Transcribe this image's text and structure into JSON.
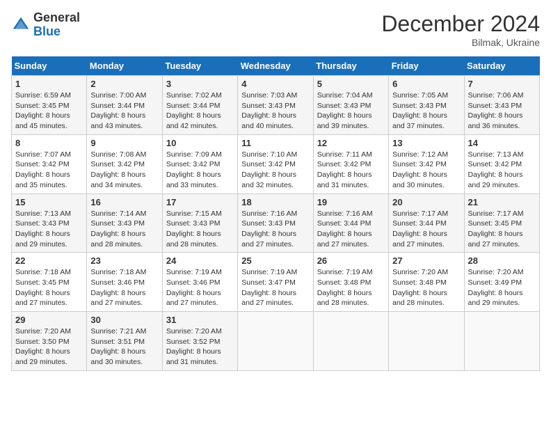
{
  "header": {
    "logo_general": "General",
    "logo_blue": "Blue",
    "month_title": "December 2024",
    "subtitle": "Bilmak, Ukraine"
  },
  "weekdays": [
    "Sunday",
    "Monday",
    "Tuesday",
    "Wednesday",
    "Thursday",
    "Friday",
    "Saturday"
  ],
  "weeks": [
    [
      {
        "day": "1",
        "sunrise": "Sunrise: 6:59 AM",
        "sunset": "Sunset: 3:45 PM",
        "daylight": "Daylight: 8 hours and 45 minutes."
      },
      {
        "day": "2",
        "sunrise": "Sunrise: 7:00 AM",
        "sunset": "Sunset: 3:44 PM",
        "daylight": "Daylight: 8 hours and 43 minutes."
      },
      {
        "day": "3",
        "sunrise": "Sunrise: 7:02 AM",
        "sunset": "Sunset: 3:44 PM",
        "daylight": "Daylight: 8 hours and 42 minutes."
      },
      {
        "day": "4",
        "sunrise": "Sunrise: 7:03 AM",
        "sunset": "Sunset: 3:43 PM",
        "daylight": "Daylight: 8 hours and 40 minutes."
      },
      {
        "day": "5",
        "sunrise": "Sunrise: 7:04 AM",
        "sunset": "Sunset: 3:43 PM",
        "daylight": "Daylight: 8 hours and 39 minutes."
      },
      {
        "day": "6",
        "sunrise": "Sunrise: 7:05 AM",
        "sunset": "Sunset: 3:43 PM",
        "daylight": "Daylight: 8 hours and 37 minutes."
      },
      {
        "day": "7",
        "sunrise": "Sunrise: 7:06 AM",
        "sunset": "Sunset: 3:43 PM",
        "daylight": "Daylight: 8 hours and 36 minutes."
      }
    ],
    [
      {
        "day": "8",
        "sunrise": "Sunrise: 7:07 AM",
        "sunset": "Sunset: 3:42 PM",
        "daylight": "Daylight: 8 hours and 35 minutes."
      },
      {
        "day": "9",
        "sunrise": "Sunrise: 7:08 AM",
        "sunset": "Sunset: 3:42 PM",
        "daylight": "Daylight: 8 hours and 34 minutes."
      },
      {
        "day": "10",
        "sunrise": "Sunrise: 7:09 AM",
        "sunset": "Sunset: 3:42 PM",
        "daylight": "Daylight: 8 hours and 33 minutes."
      },
      {
        "day": "11",
        "sunrise": "Sunrise: 7:10 AM",
        "sunset": "Sunset: 3:42 PM",
        "daylight": "Daylight: 8 hours and 32 minutes."
      },
      {
        "day": "12",
        "sunrise": "Sunrise: 7:11 AM",
        "sunset": "Sunset: 3:42 PM",
        "daylight": "Daylight: 8 hours and 31 minutes."
      },
      {
        "day": "13",
        "sunrise": "Sunrise: 7:12 AM",
        "sunset": "Sunset: 3:42 PM",
        "daylight": "Daylight: 8 hours and 30 minutes."
      },
      {
        "day": "14",
        "sunrise": "Sunrise: 7:13 AM",
        "sunset": "Sunset: 3:42 PM",
        "daylight": "Daylight: 8 hours and 29 minutes."
      }
    ],
    [
      {
        "day": "15",
        "sunrise": "Sunrise: 7:13 AM",
        "sunset": "Sunset: 3:43 PM",
        "daylight": "Daylight: 8 hours and 29 minutes."
      },
      {
        "day": "16",
        "sunrise": "Sunrise: 7:14 AM",
        "sunset": "Sunset: 3:43 PM",
        "daylight": "Daylight: 8 hours and 28 minutes."
      },
      {
        "day": "17",
        "sunrise": "Sunrise: 7:15 AM",
        "sunset": "Sunset: 3:43 PM",
        "daylight": "Daylight: 8 hours and 28 minutes."
      },
      {
        "day": "18",
        "sunrise": "Sunrise: 7:16 AM",
        "sunset": "Sunset: 3:43 PM",
        "daylight": "Daylight: 8 hours and 27 minutes."
      },
      {
        "day": "19",
        "sunrise": "Sunrise: 7:16 AM",
        "sunset": "Sunset: 3:44 PM",
        "daylight": "Daylight: 8 hours and 27 minutes."
      },
      {
        "day": "20",
        "sunrise": "Sunrise: 7:17 AM",
        "sunset": "Sunset: 3:44 PM",
        "daylight": "Daylight: 8 hours and 27 minutes."
      },
      {
        "day": "21",
        "sunrise": "Sunrise: 7:17 AM",
        "sunset": "Sunset: 3:45 PM",
        "daylight": "Daylight: 8 hours and 27 minutes."
      }
    ],
    [
      {
        "day": "22",
        "sunrise": "Sunrise: 7:18 AM",
        "sunset": "Sunset: 3:45 PM",
        "daylight": "Daylight: 8 hours and 27 minutes."
      },
      {
        "day": "23",
        "sunrise": "Sunrise: 7:18 AM",
        "sunset": "Sunset: 3:46 PM",
        "daylight": "Daylight: 8 hours and 27 minutes."
      },
      {
        "day": "24",
        "sunrise": "Sunrise: 7:19 AM",
        "sunset": "Sunset: 3:46 PM",
        "daylight": "Daylight: 8 hours and 27 minutes."
      },
      {
        "day": "25",
        "sunrise": "Sunrise: 7:19 AM",
        "sunset": "Sunset: 3:47 PM",
        "daylight": "Daylight: 8 hours and 27 minutes."
      },
      {
        "day": "26",
        "sunrise": "Sunrise: 7:19 AM",
        "sunset": "Sunset: 3:48 PM",
        "daylight": "Daylight: 8 hours and 28 minutes."
      },
      {
        "day": "27",
        "sunrise": "Sunrise: 7:20 AM",
        "sunset": "Sunset: 3:48 PM",
        "daylight": "Daylight: 8 hours and 28 minutes."
      },
      {
        "day": "28",
        "sunrise": "Sunrise: 7:20 AM",
        "sunset": "Sunset: 3:49 PM",
        "daylight": "Daylight: 8 hours and 29 minutes."
      }
    ],
    [
      {
        "day": "29",
        "sunrise": "Sunrise: 7:20 AM",
        "sunset": "Sunset: 3:50 PM",
        "daylight": "Daylight: 8 hours and 29 minutes."
      },
      {
        "day": "30",
        "sunrise": "Sunrise: 7:21 AM",
        "sunset": "Sunset: 3:51 PM",
        "daylight": "Daylight: 8 hours and 30 minutes."
      },
      {
        "day": "31",
        "sunrise": "Sunrise: 7:20 AM",
        "sunset": "Sunset: 3:52 PM",
        "daylight": "Daylight: 8 hours and 31 minutes."
      },
      null,
      null,
      null,
      null
    ]
  ]
}
